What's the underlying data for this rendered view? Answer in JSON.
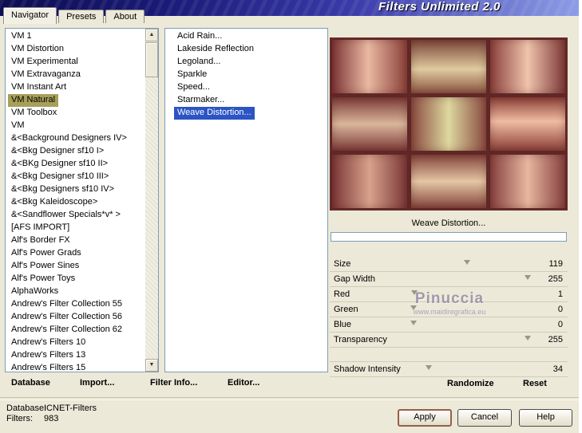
{
  "window": {
    "title": "Filters Unlimited 2.0"
  },
  "colors": {
    "titlebar_blue": "#1b1b7a",
    "selection_blue": "#2b54c4",
    "selection_olive": "#a6a05a",
    "dialog_background": "#ece9d8"
  },
  "tabs": [
    {
      "label": "Navigator",
      "selected": true
    },
    {
      "label": "Presets"
    },
    {
      "label": "About"
    }
  ],
  "icons": {
    "scroll_up": "▲",
    "scroll_down": "▼"
  },
  "categories": [
    {
      "label": "VM 1"
    },
    {
      "label": "VM Distortion"
    },
    {
      "label": "VM Experimental"
    },
    {
      "label": "VM Extravaganza"
    },
    {
      "label": "VM Instant Art"
    },
    {
      "label": "VM Natural",
      "selected": true
    },
    {
      "label": "VM Toolbox"
    },
    {
      "label": "VM"
    },
    {
      "label": "&<Background Designers IV>"
    },
    {
      "label": "&<Bkg Designer sf10 I>"
    },
    {
      "label": "&<BKg Designer sf10 II>"
    },
    {
      "label": "&<Bkg Designer sf10 III>"
    },
    {
      "label": "&<Bkg Designers sf10 IV>"
    },
    {
      "label": "&<Bkg Kaleidoscope>"
    },
    {
      "label": "&<Sandflower Specials*v* >"
    },
    {
      "label": "[AFS IMPORT]"
    },
    {
      "label": "Alf's Border FX"
    },
    {
      "label": "Alf's Power Grads"
    },
    {
      "label": "Alf's Power Sines"
    },
    {
      "label": "Alf's Power Toys"
    },
    {
      "label": "AlphaWorks"
    },
    {
      "label": "Andrew's Filter Collection 55"
    },
    {
      "label": "Andrew's Filter Collection 56"
    },
    {
      "label": "Andrew's Filter Collection 62"
    },
    {
      "label": "Andrew's Filters 10"
    },
    {
      "label": "Andrew's Filters 13"
    },
    {
      "label": "Andrew's Filters 15"
    }
  ],
  "filters": [
    {
      "label": "Acid Rain..."
    },
    {
      "label": "Lakeside Reflection"
    },
    {
      "label": "Legoland..."
    },
    {
      "label": "Sparkle"
    },
    {
      "label": "Speed..."
    },
    {
      "label": "Starmaker..."
    },
    {
      "label": "Weave Distortion...",
      "selected": true
    }
  ],
  "preview": {
    "caption": "Weave Distortion..."
  },
  "params": [
    {
      "label": "Size",
      "value": 119
    },
    {
      "label": "Gap Width",
      "value": 255
    },
    {
      "label": "Red",
      "value": 1
    },
    {
      "label": "Green",
      "value": 0
    },
    {
      "label": "Blue",
      "value": 0
    },
    {
      "label": "Transparency",
      "value": 255
    },
    {
      "label": "Shadow Intensity",
      "value": 34,
      "gap_before": true
    }
  ],
  "watermark": {
    "line1": "Pinuccia",
    "line2": "www.maidiregrafica.eu"
  },
  "toolbar": {
    "database": "Database",
    "import": "Import...",
    "filter_info": "Filter Info...",
    "editor": "Editor...",
    "randomize": "Randomize",
    "reset": "Reset"
  },
  "status": {
    "database_label": "Database:",
    "database_value": "ICNET-Filters",
    "filters_label": "Filters:",
    "filters_value": "983"
  },
  "buttons": {
    "apply": "Apply",
    "cancel": "Cancel",
    "help": "Help"
  }
}
